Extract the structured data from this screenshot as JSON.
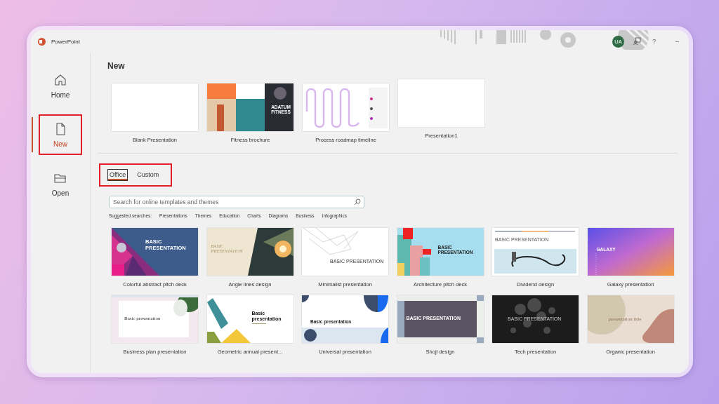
{
  "app": {
    "name": "PowerPoint"
  },
  "account": {
    "initials": "UA"
  },
  "window_controls": [
    {
      "kind": "help",
      "label": "?"
    },
    {
      "kind": "minimize",
      "label": "–"
    }
  ],
  "nav": [
    {
      "label": "Home",
      "kind": "home",
      "selected": false,
      "highlighted": false
    },
    {
      "label": "New",
      "kind": "file",
      "selected": true,
      "highlighted": true
    },
    {
      "label": "Open",
      "kind": "folder",
      "selected": false,
      "highlighted": false
    }
  ],
  "new_section": {
    "heading": "New",
    "items": [
      {
        "label": "Blank Presentation",
        "kind": "blank"
      },
      {
        "label": "Fitness brochure",
        "kind": "fitness",
        "thumb_text": "ADATUM FITNESS"
      },
      {
        "label": "Process roadmap timeline",
        "kind": "roadmap"
      },
      {
        "label": "Presentation1",
        "kind": "recent"
      }
    ]
  },
  "tabs": {
    "highlighted": true,
    "items": [
      {
        "label": "Office",
        "selected": true
      },
      {
        "label": "Custom",
        "selected": false
      }
    ]
  },
  "search": {
    "placeholder": "Search for online templates and themes"
  },
  "suggested": {
    "label": "Suggested searches:",
    "items": [
      "Presentations",
      "Themes",
      "Education",
      "Charts",
      "Diagrams",
      "Business",
      "Infographics"
    ]
  },
  "templates": [
    {
      "label": "Colorful abstract pitch deck",
      "kind": "colorful",
      "thumb_text": "BASIC PRESENTATION"
    },
    {
      "label": "Angle lines design",
      "kind": "angle",
      "thumb_text": "BASIC PRESENTATION"
    },
    {
      "label": "Minimalist presentation",
      "kind": "minimalist",
      "thumb_text": "BASIC PRESENTATION"
    },
    {
      "label": "Architecture pitch deck",
      "kind": "architecture",
      "thumb_text": "BASIC PRESENTATION"
    },
    {
      "label": "Dividend design",
      "kind": "dividend",
      "thumb_text": "BASIC PRESENTATION"
    },
    {
      "label": "Galaxy presentation",
      "kind": "galaxy",
      "thumb_text": "GALAXY"
    },
    {
      "label": "Business plan presentation",
      "kind": "business",
      "thumb_text": "Basic presentation"
    },
    {
      "label": "Geometric annual present...",
      "kind": "geometric",
      "thumb_text": "Basic presentation"
    },
    {
      "label": "Universal presentation",
      "kind": "universal",
      "thumb_text": "Basic presentation"
    },
    {
      "label": "Shoji design",
      "kind": "shoji",
      "thumb_text": "BASIC PRESENTATION"
    },
    {
      "label": "Tech presentation",
      "kind": "tech",
      "thumb_text": "BASIC PRESENTATION"
    },
    {
      "label": "Organic presentation",
      "kind": "organic",
      "thumb_text": "presentation title"
    }
  ]
}
